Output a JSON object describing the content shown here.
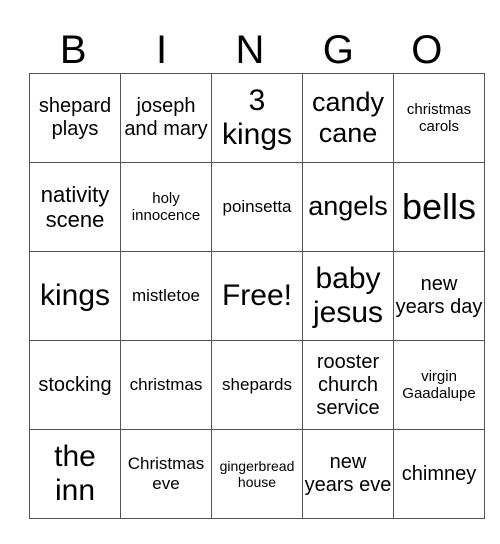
{
  "header": {
    "letters": [
      "B",
      "I",
      "N",
      "G",
      "O"
    ]
  },
  "card": {
    "rows": [
      [
        "shepard plays",
        "joseph and mary",
        "3 kings",
        "candy cane",
        "christmas carols"
      ],
      [
        "nativity scene",
        "holy innocence",
        "poinsetta",
        "angels",
        "bells"
      ],
      [
        "kings",
        "mistletoe",
        "Free!",
        "baby jesus",
        "new years day"
      ],
      [
        "stocking",
        "christmas",
        "shepards",
        "rooster church service",
        "virgin Gaadalupe"
      ],
      [
        "the inn",
        "Christmas eve",
        "gingerbread house",
        "new years eve",
        "chimney"
      ]
    ]
  },
  "colors": {
    "border": "#555555",
    "text": "#000000",
    "background": "#ffffff"
  }
}
